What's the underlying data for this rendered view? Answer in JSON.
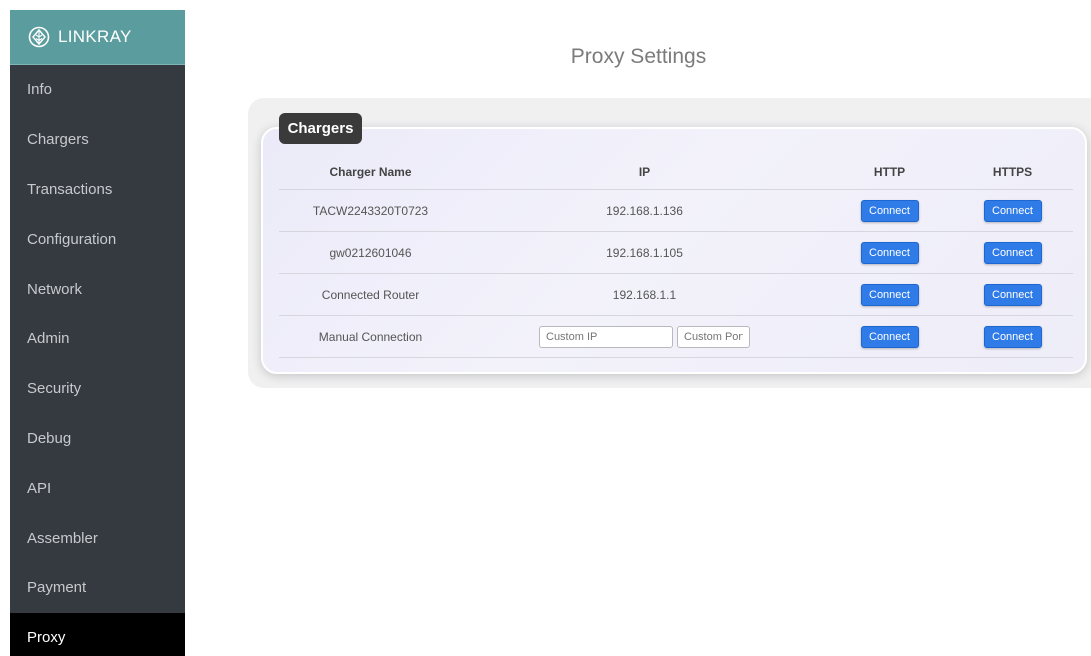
{
  "brand": {
    "name": "LINKRAY",
    "icon": "leaf-diamond-icon"
  },
  "sidebar": {
    "items": [
      {
        "label": "Info"
      },
      {
        "label": "Chargers"
      },
      {
        "label": "Transactions"
      },
      {
        "label": "Configuration"
      },
      {
        "label": "Network"
      },
      {
        "label": "Admin"
      },
      {
        "label": "Security"
      },
      {
        "label": "Debug"
      },
      {
        "label": "API"
      },
      {
        "label": "Assembler"
      },
      {
        "label": "Payment"
      },
      {
        "label": "Proxy",
        "active": true
      }
    ]
  },
  "page": {
    "title": "Proxy Settings"
  },
  "chargers": {
    "label": "Chargers",
    "headers": [
      "Charger Name",
      "IP",
      "HTTP",
      "HTTPS"
    ],
    "button_label": "Connect",
    "rows": [
      {
        "name": "TACW2243320T0723",
        "ip": "192.168.1.136"
      },
      {
        "name": "gw0212601046",
        "ip": "192.168.1.105"
      },
      {
        "name": "Connected Router",
        "ip": "192.168.1.1"
      }
    ],
    "manual": {
      "name": "Manual Connection",
      "ip_placeholder": "Custom IP",
      "port_placeholder": "Custom Port"
    }
  },
  "colors": {
    "sidebar_bg": "#343a40",
    "brand_bg": "#5b9d9e",
    "button": "#2f7be8",
    "active_item": "#000000"
  }
}
